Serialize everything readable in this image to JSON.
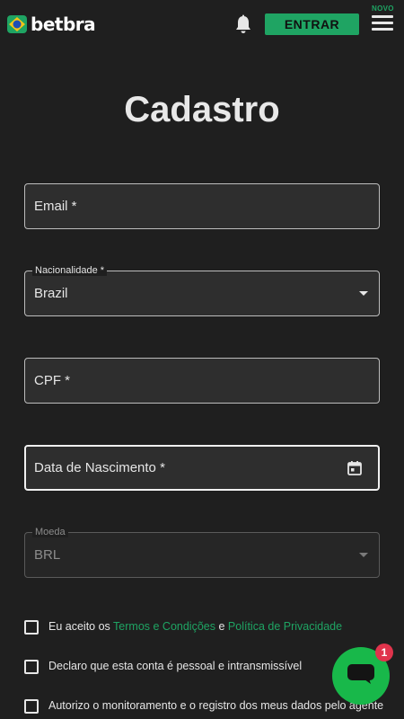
{
  "header": {
    "logo_text": "betbra",
    "enter_label": "ENTRAR",
    "new_badge": "NOVO",
    "colors": {
      "accent": "#1fa463",
      "background": "#1f1f1f"
    }
  },
  "page": {
    "title": "Cadastro"
  },
  "form": {
    "email": {
      "label": "Email *"
    },
    "nationality": {
      "legend": "Nacionalidade *",
      "value": "Brazil"
    },
    "cpf": {
      "label": "CPF *"
    },
    "birth_date": {
      "label": "Data de Nascimento *"
    },
    "currency": {
      "legend": "Moeda",
      "value": "BRL"
    }
  },
  "consents": {
    "terms": {
      "prefix": "Eu aceito os",
      "terms_link": "Termos e Condições",
      "conjunction": "e",
      "privacy_link": "Política de Privacidade"
    },
    "personal": {
      "text": "Declaro que esta conta é pessoal e intransmissível"
    },
    "monitoring": {
      "text": "Autorizo o monitoramento e o registro dos meus dados pelo agente"
    }
  },
  "chat": {
    "badge_count": "1"
  }
}
